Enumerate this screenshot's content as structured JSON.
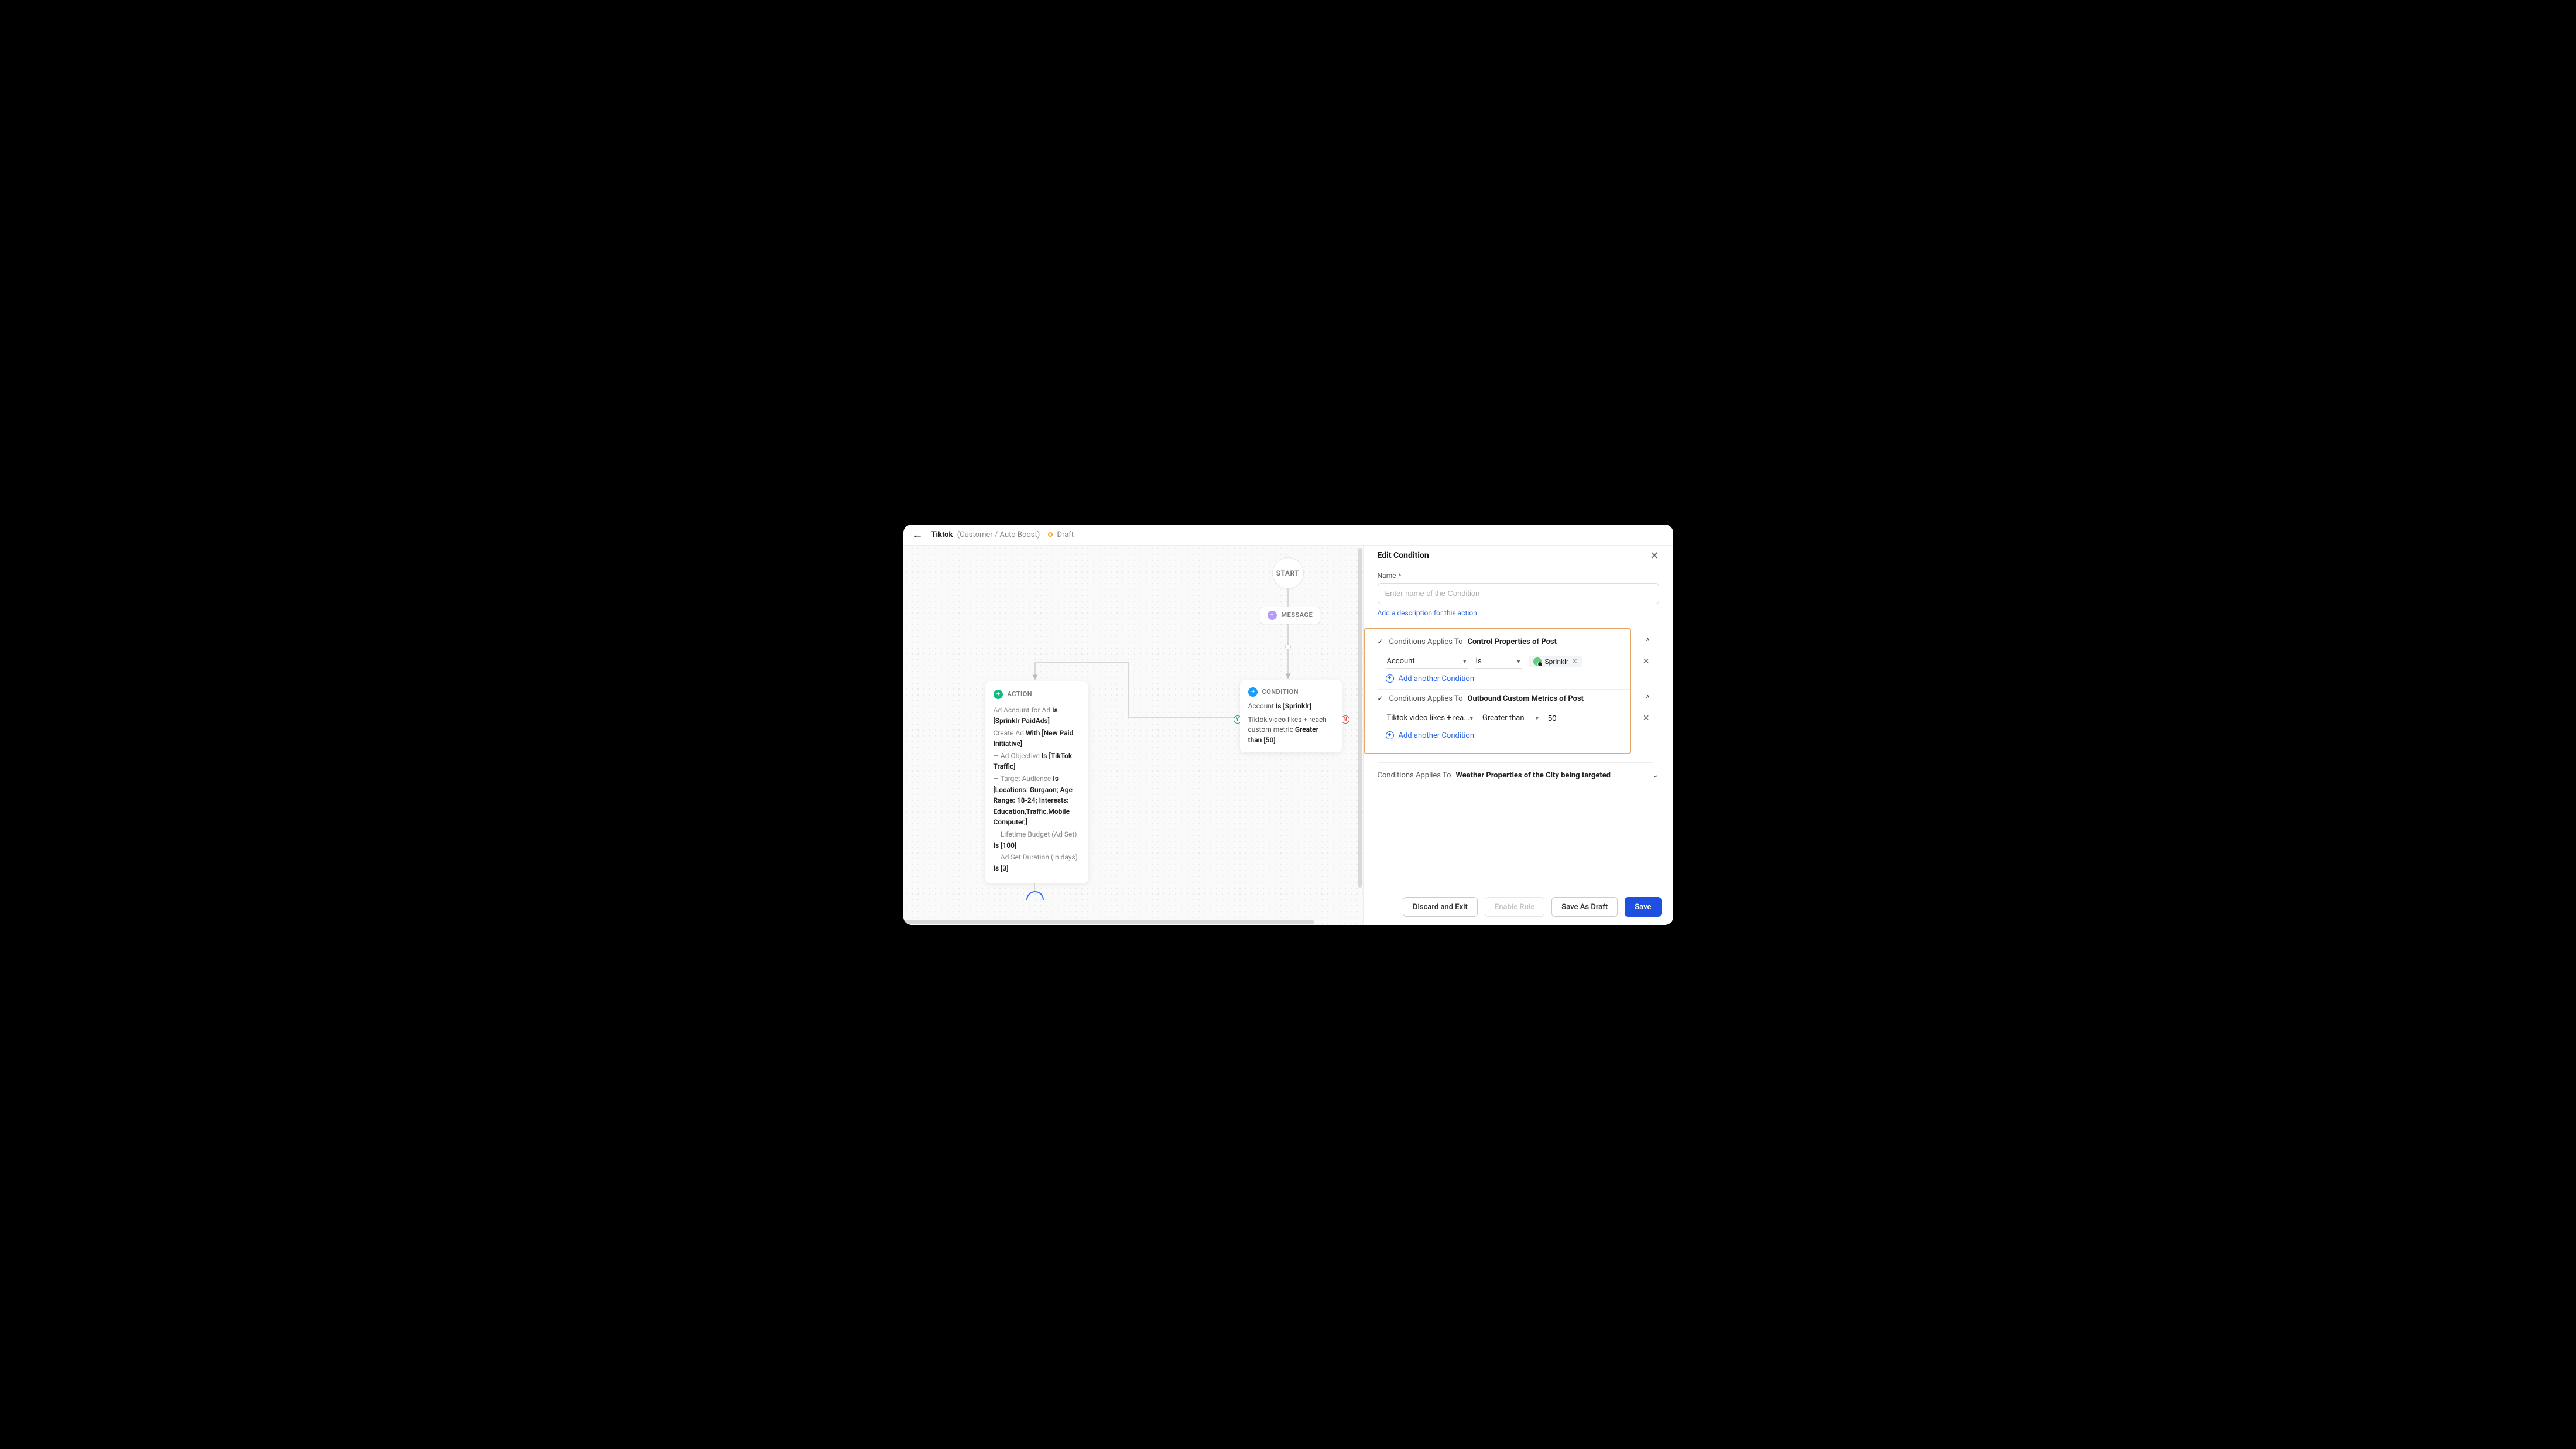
{
  "header": {
    "title": "Tiktok",
    "path": "(Customer / Auto Boost)",
    "status": "Draft"
  },
  "canvas": {
    "start": "START",
    "message_label": "MESSAGE",
    "condition": {
      "label": "CONDITION",
      "line1_pre": "Account",
      "line1_mid": "Is",
      "line1_post": "[Sprinklr]",
      "line2_pre": "Tiktok video likes + reach custom metric",
      "line2_mid": "Greater than",
      "line2_post": "[50]"
    },
    "y_badge": "Y",
    "n_badge": "N",
    "action": {
      "label": "ACTION",
      "r1_a": "Ad Account for Ad",
      "r1_b": "Is",
      "r1_c": "[Sprinklr PaidAds]",
      "r2_a": "Create Ad",
      "r2_b": "With",
      "r2_c": "[New Paid Initiative]",
      "r3_a": "— Ad Objective",
      "r3_b": "Is",
      "r3_c": "[TikTok Traffic]",
      "r4_a": "— Target Audience",
      "r4_b": "Is",
      "r4_c": "[Locations: Gurgaon; Age Range: 18-24; Interests: Education,Traffic,Mobile Computer,]",
      "r5_a": "— Lifetime Budget (Ad Set)",
      "r5_b": "Is",
      "r5_c": "[100]",
      "r6_a": "— Ad Set Duration (in days)",
      "r6_b": "Is",
      "r6_c": "[3]"
    }
  },
  "panel": {
    "title": "Edit Condition",
    "name_label": "Name",
    "name_placeholder": "Enter name of the Condition",
    "desc_link": "Add a description for this action",
    "section1": {
      "prefix": "Conditions Applies To",
      "strong": "Control Properties of Post",
      "field": "Account",
      "op": "Is",
      "chip": "Sprinklr",
      "add": "Add another Condition"
    },
    "section2": {
      "prefix": "Conditions Applies To",
      "strong": "Outbound Custom Metrics of Post",
      "field": "Tiktok video likes + rea...",
      "op": "Greater than",
      "value": "50",
      "add": "Add another Condition"
    },
    "section3": {
      "prefix": "Conditions Applies To",
      "strong": "Weather Properties of the City being targeted"
    }
  },
  "footer": {
    "discard": "Discard and Exit",
    "enable": "Enable Rule",
    "draft": "Save As Draft",
    "save": "Save"
  }
}
